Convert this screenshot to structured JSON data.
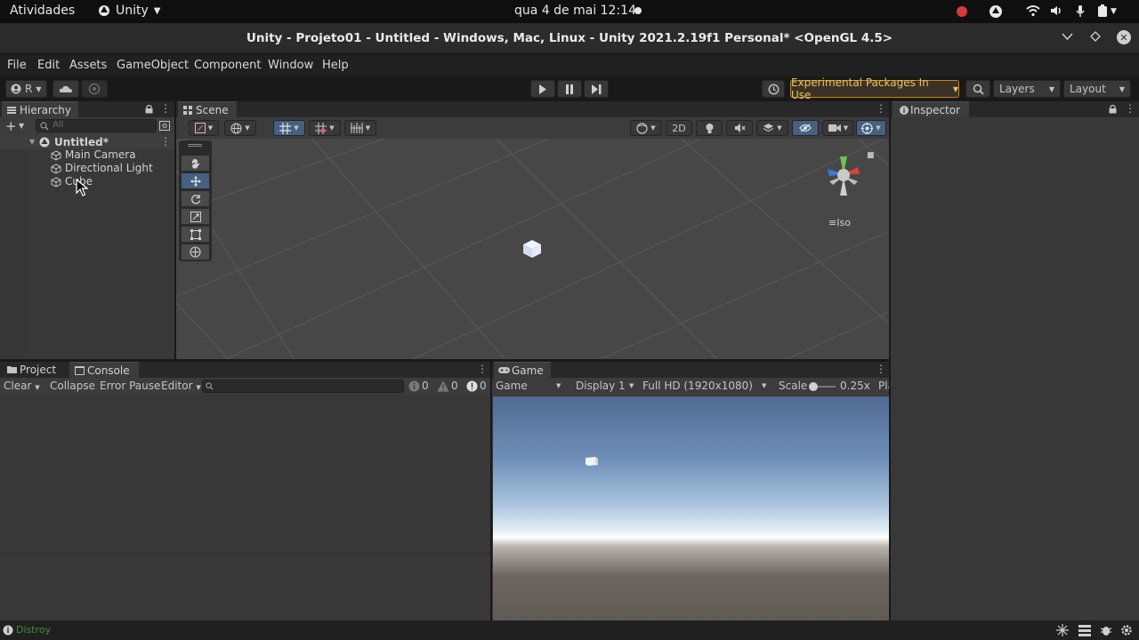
{
  "system_bar": {
    "activities": "Atividades",
    "app_name": "Unity",
    "datetime": "qua 4 de mai  12:14"
  },
  "window": {
    "title": "Unity - Projeto01 - Untitled - Windows, Mac, Linux - Unity 2021.2.19f1 Personal* <OpenGL 4.5>"
  },
  "menu": [
    "File",
    "Edit",
    "Assets",
    "GameObject",
    "Component",
    "Window",
    "Help"
  ],
  "toolbar": {
    "account_label": "R",
    "experimental_badge": "Experimental Packages In Use",
    "layers_label": "Layers",
    "layout_label": "Layout"
  },
  "hierarchy": {
    "tab_label": "Hierarchy",
    "search_placeholder": "All",
    "scene_name": "Untitled*",
    "objects": [
      "Main Camera",
      "Directional Light",
      "Cube"
    ]
  },
  "scene": {
    "tab_label": "Scene",
    "mode_2d": "2D",
    "projection_label": "Iso"
  },
  "inspector": {
    "tab_label": "Inspector"
  },
  "bottom_tabs": {
    "project": "Project",
    "console": "Console"
  },
  "console": {
    "clear": "Clear",
    "collapse": "Collapse",
    "error_pause": "Error Pause",
    "editor": "Editor",
    "log_count": "0",
    "warning_count": "0",
    "error_count": "0"
  },
  "game": {
    "tab_label": "Game",
    "view_mode": "Game",
    "display": "Display 1",
    "resolution": "Full HD (1920x1080)",
    "scale_label": "Scale",
    "scale_value": "0.25x",
    "play_truncated": "Pla"
  },
  "status_bar": {
    "message": "Distroy"
  },
  "colors": {
    "accent_blue": "#3a5f8e",
    "badge_orange": "#c7840f",
    "record_red": "#d63b3b"
  }
}
